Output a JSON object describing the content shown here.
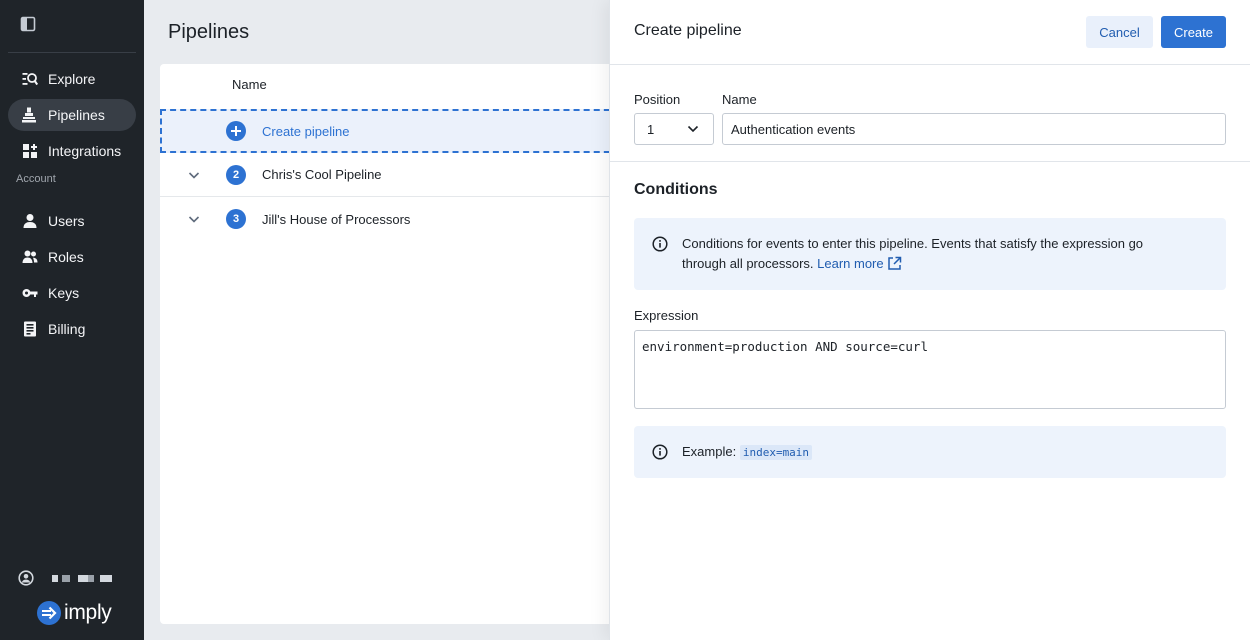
{
  "sidebar": {
    "items": [
      {
        "label": "Explore",
        "icon": "explore-icon"
      },
      {
        "label": "Pipelines",
        "icon": "pipelines-icon",
        "active": true
      },
      {
        "label": "Integrations",
        "icon": "integrations-icon"
      }
    ],
    "section_label": "Account",
    "account_items": [
      {
        "label": "Users",
        "icon": "user-icon"
      },
      {
        "label": "Roles",
        "icon": "roles-icon"
      },
      {
        "label": "Keys",
        "icon": "key-icon"
      },
      {
        "label": "Billing",
        "icon": "billing-icon"
      }
    ],
    "logo_text": "imply"
  },
  "main": {
    "title": "Pipelines",
    "table": {
      "column_header": "Name",
      "create_row_label": "Create pipeline",
      "rows": [
        {
          "index": "2",
          "name": "Chris's Cool Pipeline"
        },
        {
          "index": "3",
          "name": "Jill's House of Processors"
        }
      ]
    }
  },
  "drawer": {
    "title": "Create pipeline",
    "cancel_label": "Cancel",
    "create_label": "Create",
    "position_label": "Position",
    "position_value": "1",
    "name_label": "Name",
    "name_value": "Authentication events",
    "conditions_title": "Conditions",
    "conditions_info_line1": "Conditions for events to enter this pipeline. Events that satisfy the expression go",
    "conditions_info_line2": "through all processors.",
    "learn_more": "Learn more",
    "expression_label": "Expression",
    "expression_value": "environment=production AND source=curl",
    "example_label": "Example:",
    "example_code": "index=main"
  },
  "colors": {
    "sidebar_bg": "#1f2429",
    "accent": "#2d72d2",
    "callout_bg": "#edf3fc"
  }
}
